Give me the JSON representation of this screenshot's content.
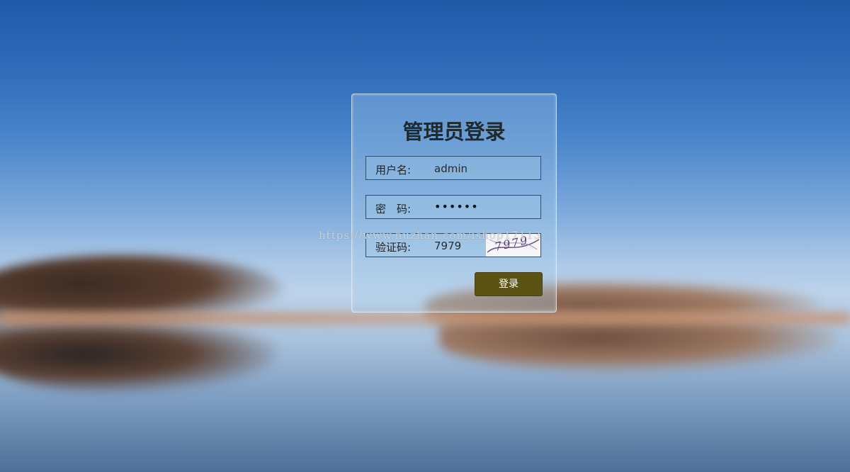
{
  "login": {
    "title": "管理员登录",
    "username_label": "用户名:",
    "username_value": "admin",
    "password_label": "密　码:",
    "password_value": "••••••",
    "captcha_label": "验证码:",
    "captcha_value": "7979",
    "captcha_image_text": "7979",
    "submit_label": "登录"
  },
  "overlay": {
    "watermark": "https://www.huzhan.com/ishop17113"
  },
  "colors": {
    "button_bg": "#5b5214",
    "panel_border": "#e6f0ff",
    "field_border": "#2f4f6e",
    "sky_top": "#1f5aa8"
  }
}
